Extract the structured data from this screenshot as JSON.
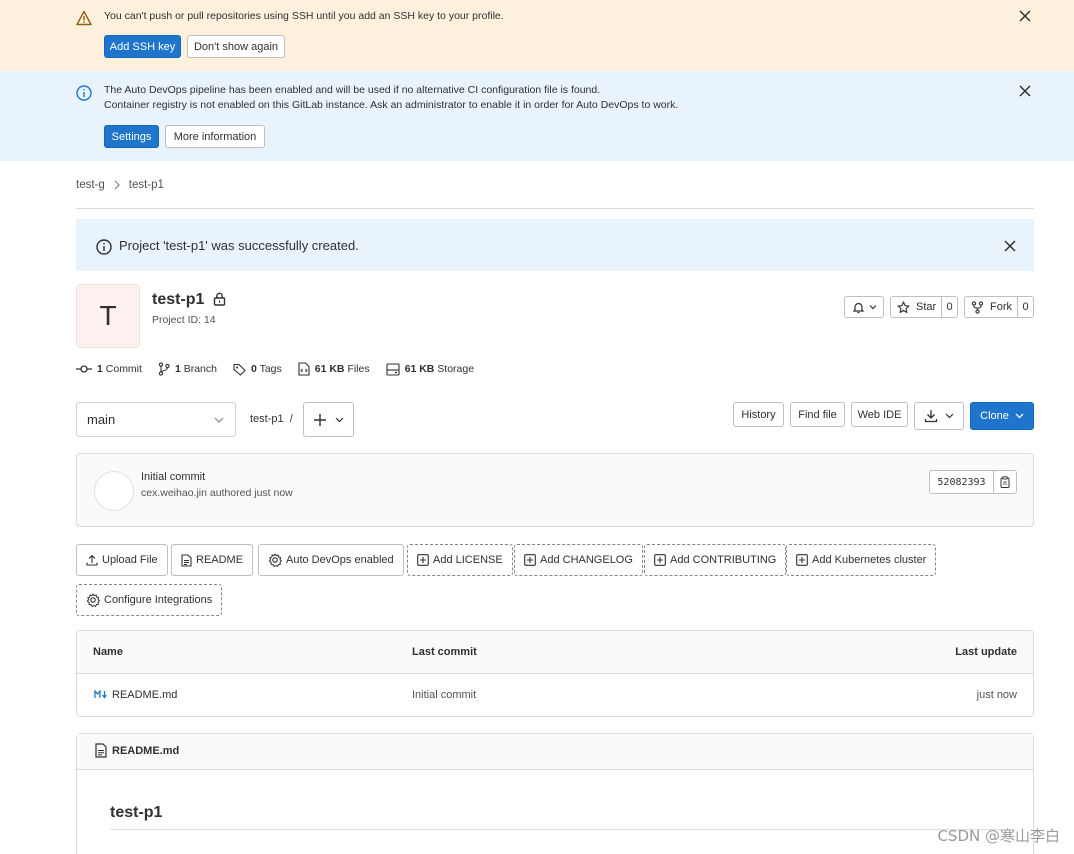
{
  "ssh_alert": {
    "message": "You can't push or pull repositories using SSH until you add an SSH key to your profile.",
    "primary_label": "Add SSH key",
    "secondary_label": "Don't show again"
  },
  "devops_alert": {
    "line1": "The Auto DevOps pipeline has been enabled and will be used if no alternative CI configuration file is found.",
    "line2": "Container registry is not enabled on this GitLab instance. Ask an administrator to enable it in order for Auto DevOps to work.",
    "primary_label": "Settings",
    "secondary_label": "More information"
  },
  "breadcrumb": {
    "group": "test-g",
    "project": "test-p1"
  },
  "flash": {
    "message": "Project 'test-p1' was successfully created."
  },
  "project": {
    "avatar_letter": "T",
    "name": "test-p1",
    "id_text": "Project ID: 14",
    "star_label": "Star",
    "star_count": "0",
    "fork_label": "Fork",
    "fork_count": "0"
  },
  "stats": {
    "commits_count": "1",
    "commits_label": "Commit",
    "branches_count": "1",
    "branches_label": "Branch",
    "tags_count": "0",
    "tags_label": "Tags",
    "files_size": "61 KB",
    "files_label": "Files",
    "storage_size": "61 KB",
    "storage_label": "Storage"
  },
  "repo_toolbar": {
    "branch": "main",
    "path": "test-p1",
    "path_sep": "/",
    "history_label": "History",
    "find_file_label": "Find file",
    "web_ide_label": "Web IDE",
    "clone_label": "Clone"
  },
  "last_commit": {
    "title": "Initial commit",
    "author": "cex.weihao.jin",
    "authored_text": "authored just now",
    "sha": "52082393"
  },
  "quick_actions": {
    "upload_file": "Upload File",
    "readme": "README",
    "auto_devops": "Auto DevOps enabled",
    "add_license": "Add LICENSE",
    "add_changelog": "Add CHANGELOG",
    "add_contributing": "Add CONTRIBUTING",
    "add_k8s": "Add Kubernetes cluster",
    "configure_integrations": "Configure Integrations"
  },
  "file_table": {
    "headers": {
      "name": "Name",
      "last_commit": "Last commit",
      "last_update": "Last update"
    },
    "rows": [
      {
        "name": "README.md",
        "last_commit": "Initial commit",
        "last_update": "just now"
      }
    ]
  },
  "readme": {
    "filename": "README.md",
    "heading": "test-p1"
  },
  "watermark": "CSDN @寒山李白",
  "colors": {
    "primary": "#1f75cb",
    "warning_bg": "#fdf1dd",
    "info_bg": "#e9f3fc"
  }
}
